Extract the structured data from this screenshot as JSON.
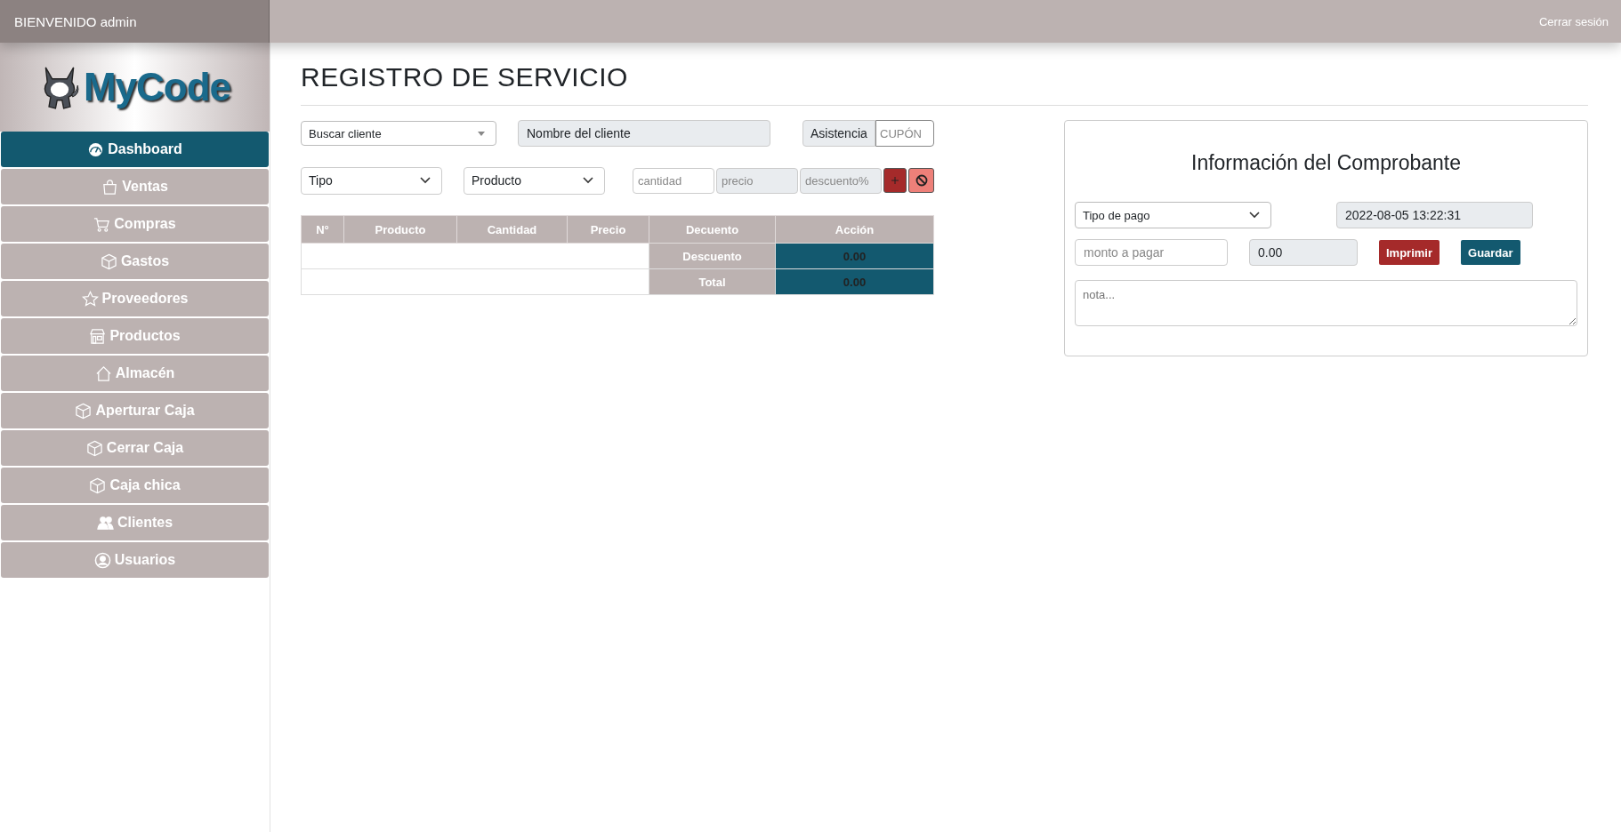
{
  "top_bar": {
    "welcome": "BIENVENIDO admin",
    "logout": "Cerrar sesión"
  },
  "logo": {
    "text": "MyCode"
  },
  "sidebar": {
    "items": [
      {
        "label": "Dashboard",
        "selected": true
      },
      {
        "label": "Ventas",
        "selected": false
      },
      {
        "label": "Compras",
        "selected": false
      },
      {
        "label": "Gastos",
        "selected": false
      },
      {
        "label": "Proveedores",
        "selected": false
      },
      {
        "label": "Productos",
        "selected": false
      },
      {
        "label": "Almacén",
        "selected": false
      },
      {
        "label": "Aperturar Caja",
        "selected": false
      },
      {
        "label": "Cerrar Caja",
        "selected": false
      },
      {
        "label": "Caja chica",
        "selected": false
      },
      {
        "label": "Clientes",
        "selected": false
      },
      {
        "label": "Usuarios",
        "selected": false
      }
    ]
  },
  "page": {
    "title": "REGISTRO DE SERVICIO"
  },
  "client_row": {
    "client_select": "Buscar cliente",
    "client_name": {
      "value": "Nombre del cliente",
      "disabled": true
    },
    "assistance_label": "Asistencia",
    "coupon": {
      "placeholder": "CUPÓN",
      "disabled": false
    }
  },
  "product_row": {
    "type_select": "Tipo",
    "product_select": "Producto",
    "fields": [
      {
        "placeholder": "cantidad",
        "disabled": false
      },
      {
        "placeholder": "precio",
        "disabled": true
      },
      {
        "placeholder": "descuento%",
        "disabled": true
      }
    ]
  },
  "table": {
    "columns": [
      "N°",
      "Producto",
      "Cantidad",
      "Precio",
      "Decuento",
      "Acción"
    ],
    "summary_rows": [
      {
        "label": "Descuento",
        "value": "0.00"
      },
      {
        "label": "Total",
        "value": "0.00"
      }
    ]
  },
  "receipt": {
    "title": "Información del Comprobante",
    "payment_select": "Tipo de pago",
    "date": {
      "value": "2022-08-05 13:22:31",
      "disabled": true
    },
    "amount": {
      "placeholder": "monto a pagar",
      "disabled": false
    },
    "change": {
      "value": "0.00",
      "disabled": true
    },
    "buttons": [
      {
        "label": "Imprimir",
        "kind": "danger"
      },
      {
        "label": "Guardar",
        "kind": "primary"
      }
    ],
    "note": {
      "placeholder": "nota..."
    }
  }
}
